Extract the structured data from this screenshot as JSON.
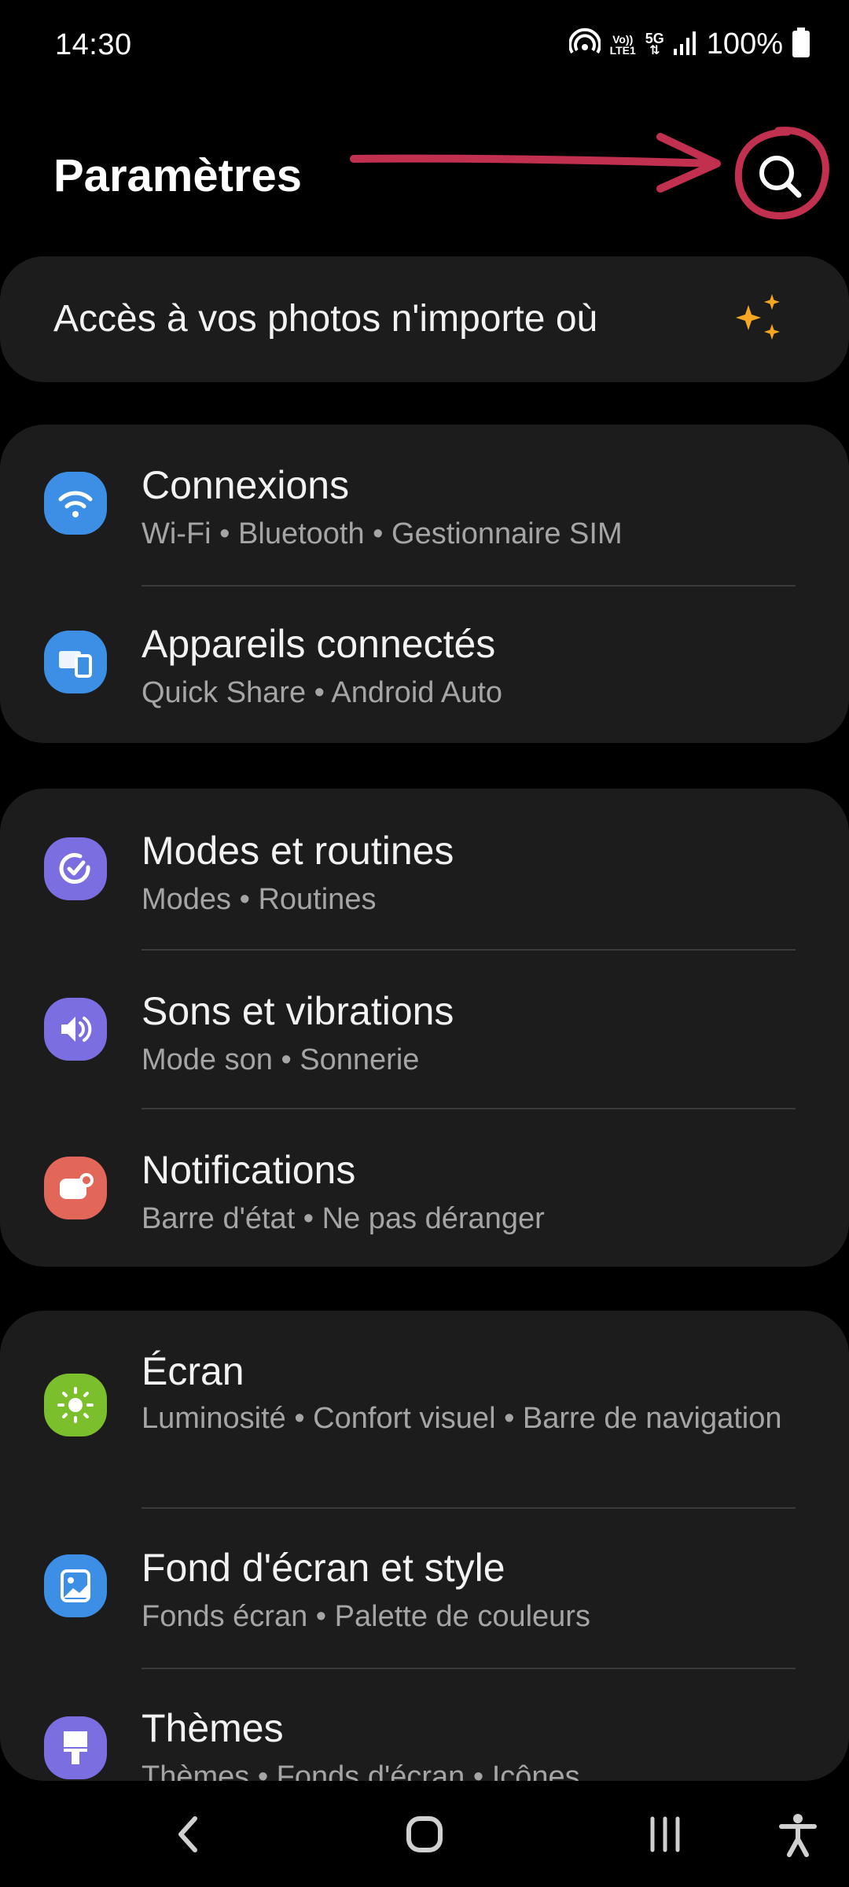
{
  "status_bar": {
    "time": "14:30",
    "volte_line1": "Vo))",
    "volte_line2": "LTE1",
    "network": "5G",
    "battery": "100%"
  },
  "header": {
    "title": "Paramètres",
    "search_icon": "search-icon"
  },
  "annotation": {
    "color": "#c2304f"
  },
  "promo": {
    "text": "Accès à vos photos n'importe où",
    "icon": "sparkle-icon",
    "icon_color": "#f5a623"
  },
  "groups": [
    {
      "items": [
        {
          "title": "Connexions",
          "subtitle": "Wi-Fi  •  Bluetooth  •  Gestionnaire SIM",
          "icon": "wifi-icon",
          "color": "#3d8fe5"
        },
        {
          "title": "Appareils connectés",
          "subtitle": "Quick Share  •  Android Auto",
          "icon": "devices-icon",
          "color": "#3d8fe5"
        }
      ]
    },
    {
      "items": [
        {
          "title": "Modes et routines",
          "subtitle": "Modes  •  Routines",
          "icon": "routines-icon",
          "color": "#7b6ee0"
        },
        {
          "title": "Sons et vibrations",
          "subtitle": "Mode son  •  Sonnerie",
          "icon": "sound-icon",
          "color": "#7b6ee0"
        },
        {
          "title": "Notifications",
          "subtitle": "Barre d'état  •  Ne pas déranger",
          "icon": "notifications-icon",
          "color": "#e3665a"
        }
      ]
    },
    {
      "items": [
        {
          "title": "Écran",
          "subtitle": "Luminosité  •  Confort visuel  •  Barre de navigation",
          "icon": "brightness-icon",
          "color": "#7cbf2c"
        },
        {
          "title": "Fond d'écran et style",
          "subtitle": "Fonds écran  •  Palette de couleurs",
          "icon": "wallpaper-icon",
          "color": "#3d8fe5"
        },
        {
          "title": "Thèmes",
          "subtitle": "Thèmes  •  Fonds d'écran  •  Icônes",
          "icon": "themes-icon",
          "color": "#7b6ee0"
        }
      ]
    }
  ],
  "nav_bar": [
    "back-icon",
    "home-icon",
    "recents-icon",
    "accessibility-icon"
  ]
}
